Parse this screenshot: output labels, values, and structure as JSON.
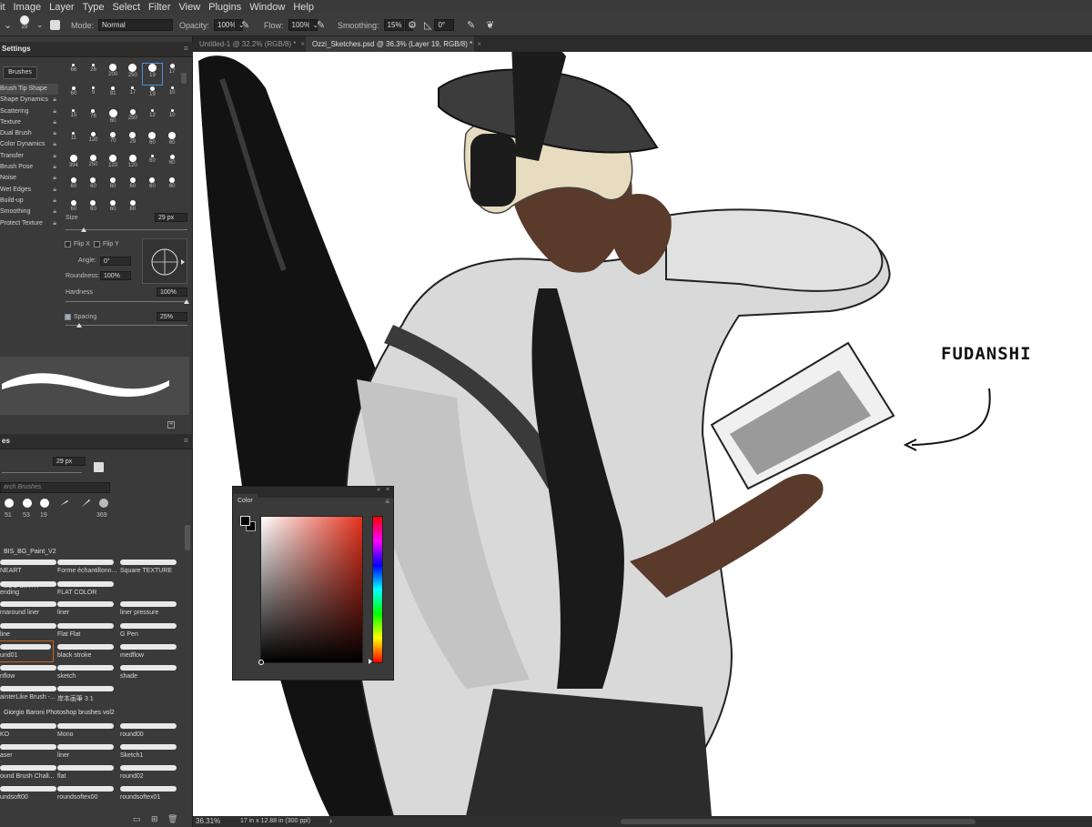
{
  "menu": [
    "it",
    "Image",
    "Layer",
    "Type",
    "Select",
    "Filter",
    "View",
    "Plugins",
    "Window",
    "Help"
  ],
  "options": {
    "brush_size": "29",
    "mode_label": "Mode:",
    "mode_value": "Normal",
    "opacity_label": "Opacity:",
    "opacity_value": "100%",
    "flow_label": "Flow:",
    "flow_value": "100%",
    "smoothing_label": "Smoothing:",
    "smoothing_value": "15%",
    "angle_value": "0°"
  },
  "tabs": [
    {
      "label": "Untitled-1 @ 32.2% (RGB/8) *",
      "active": false
    },
    {
      "label": "Ozzi_Sketches.psd @ 36.3% (Layer 19, RGB/8) *",
      "active": true
    }
  ],
  "brush_settings": {
    "title": "Settings",
    "brushes_button": "Brushes",
    "items": [
      {
        "label": "Brush Tip Shape",
        "selected": true
      },
      {
        "label": "Shape Dynamics"
      },
      {
        "label": "Scattering"
      },
      {
        "label": "Texture"
      },
      {
        "label": "Dual Brush"
      },
      {
        "label": "Color Dynamics"
      },
      {
        "label": "Transfer"
      },
      {
        "label": "Brush Pose"
      },
      {
        "label": "Noise"
      },
      {
        "label": "Wet Edges"
      },
      {
        "label": "Build-up"
      },
      {
        "label": "Smoothing"
      },
      {
        "label": "Protect Texture"
      }
    ],
    "tip_sizes": [
      "66",
      "26",
      "200",
      "250",
      "19",
      "17",
      "60",
      "9",
      "81",
      "17",
      "19",
      "10",
      "15",
      "76",
      "60",
      "250",
      "12",
      "10",
      "11",
      "120",
      "70",
      "29",
      "60",
      "60",
      "394",
      "250",
      "120",
      "120",
      "60",
      "60",
      "60",
      "60",
      "60",
      "60",
      "60",
      "60",
      "60",
      "60",
      "60",
      "60"
    ],
    "size_label": "Size",
    "size_value": "29 px",
    "flip_x": "Flip X",
    "flip_y": "Flip Y",
    "angle_label": "Angle:",
    "angle_value": "0°",
    "roundness_label": "Roundness:",
    "roundness_value": "100%",
    "hardness_label": "Hardness",
    "hardness_value": "100%",
    "spacing_label": "Spacing",
    "spacing_value": "25%"
  },
  "brushes_panel": {
    "title": "es",
    "size_value": "29 px",
    "search_placeholder": "arch Brushes",
    "recent_sizes": [
      "51",
      "53",
      "19",
      "",
      "",
      "369"
    ],
    "groups": [
      {
        "name": "BIS_BG_Paint_V2",
        "brushes": [
          "NEART",
          "Forme échantillonn...",
          "Square TEXTURE",
          "ending",
          "FLAT COLOR"
        ]
      },
      {
        "name": "EGO BIRTH",
        "brushes": [
          "rnaround liner",
          "liner",
          "liner pressure",
          "line",
          "Flat Flat",
          "G Pen",
          "und01",
          "black stroke",
          "medflow",
          "nflow",
          "sketch",
          "shade",
          "ainterLike Brush -...",
          "岸本画筆 3 1"
        ]
      },
      {
        "name": "Giorgio Baroni Photoshop brushes vol2",
        "brushes": [
          "KO",
          "Mono",
          "round00",
          "aser",
          "liner",
          "Sketch1",
          "ound Brush Chall...",
          "flat",
          "round02",
          "undsoft00",
          "roundsoftex00",
          "roundsoftex01"
        ]
      }
    ]
  },
  "color_panel": {
    "title": "Color",
    "hue_hex": "#e5311c"
  },
  "canvas_text": "FUDANSHI",
  "status": {
    "zoom": "36.31%",
    "doc_size": "17 in x 12.88 in (300 ppi)"
  }
}
